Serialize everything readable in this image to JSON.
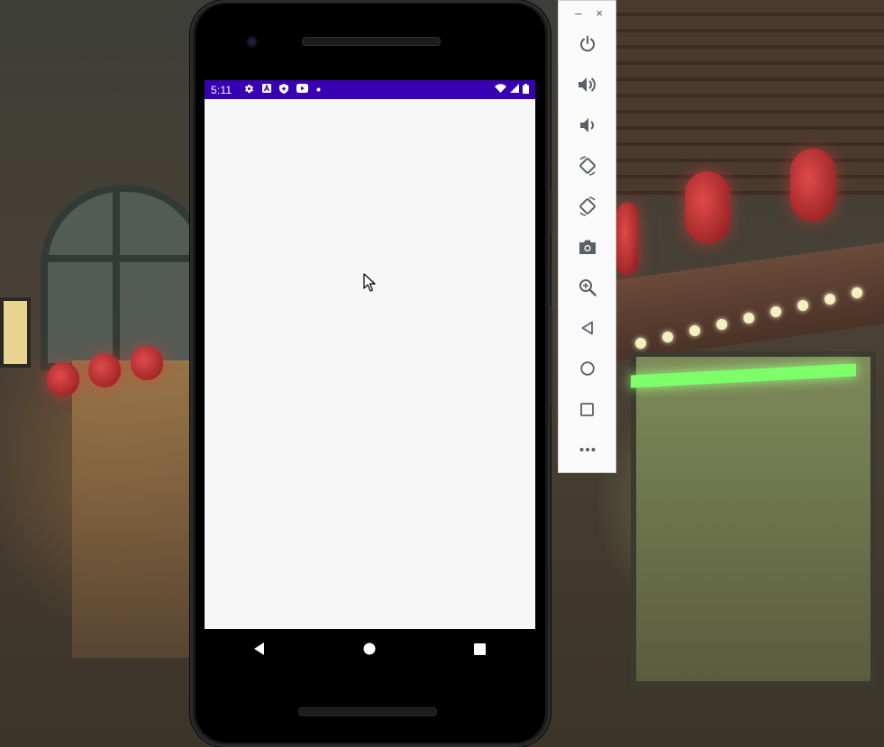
{
  "status_bar": {
    "time": "5:11",
    "left_icons": [
      "gear-icon",
      "a-icon",
      "shield-icon",
      "youtube-icon",
      "dot-icon"
    ],
    "right_icons": [
      "wifi-icon",
      "signal-icon",
      "battery-icon"
    ],
    "background_color": "#3700b3"
  },
  "screen": {
    "background_color": "#f7f7f7"
  },
  "nav_bar": {
    "buttons": [
      "back-icon",
      "home-icon",
      "recents-icon"
    ]
  },
  "emulator_toolbar": {
    "window_controls": {
      "minimize": "–",
      "close": "×"
    },
    "buttons": [
      "power",
      "volume-up",
      "volume-down",
      "rotate-left",
      "rotate-right",
      "screenshot",
      "zoom",
      "back",
      "home",
      "overview",
      "more"
    ]
  },
  "colors": {
    "accent": "#3700b3",
    "toolbar_icon": "#5b5f67"
  }
}
